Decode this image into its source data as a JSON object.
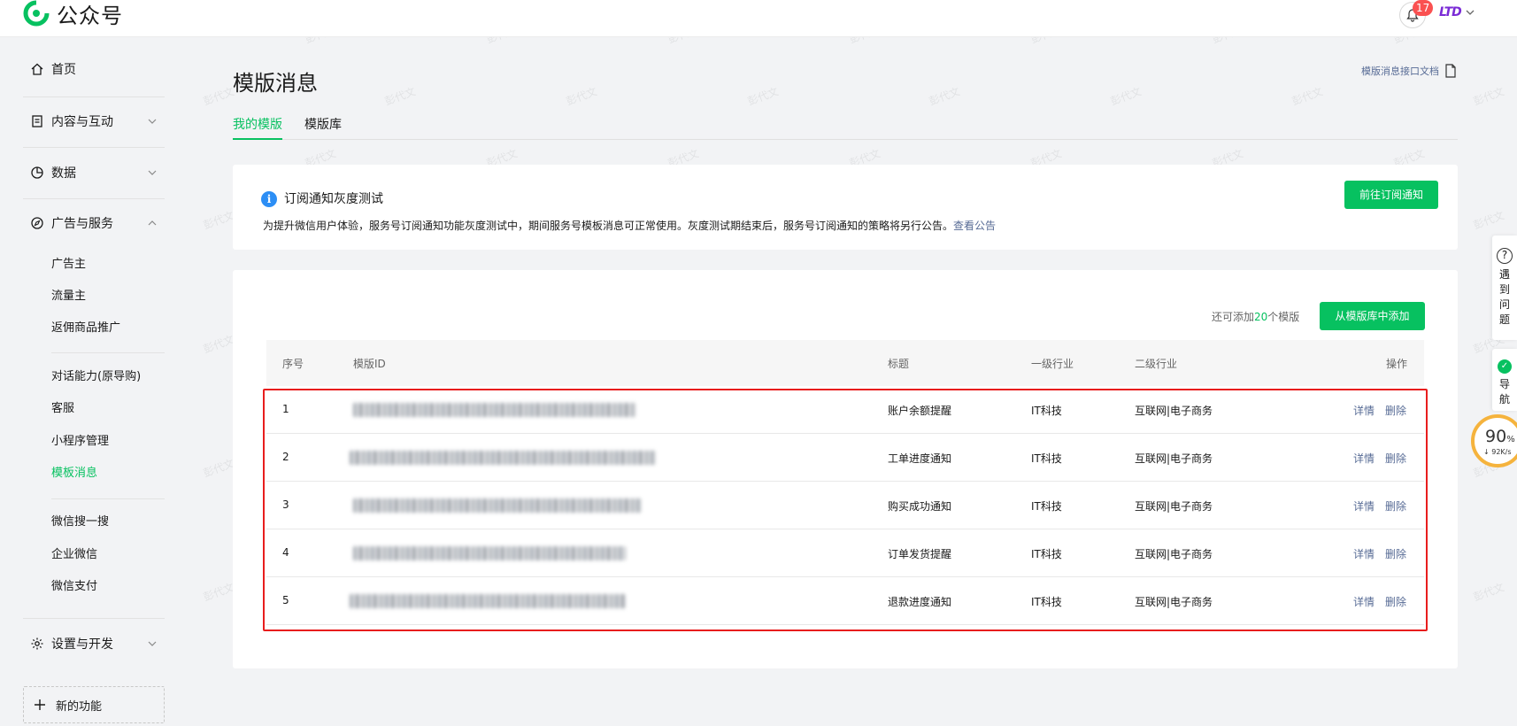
{
  "header": {
    "logo_text": "公众号",
    "notification_count": "17",
    "account_name": "LTD"
  },
  "sidebar": {
    "items": [
      {
        "label": "首页",
        "icon": "home-icon"
      },
      {
        "label": "内容与互动",
        "icon": "document-icon"
      },
      {
        "label": "数据",
        "icon": "pie-chart-icon"
      },
      {
        "label": "广告与服务",
        "icon": "compass-icon"
      },
      {
        "label": "设置与开发",
        "icon": "gear-icon"
      }
    ],
    "sub_items": [
      {
        "label": "广告主"
      },
      {
        "label": "流量主"
      },
      {
        "label": "返佣商品推广"
      },
      {
        "label": "对话能力(原导购)"
      },
      {
        "label": "客服"
      },
      {
        "label": "小程序管理"
      },
      {
        "label": "模板消息",
        "active": true
      },
      {
        "label": "微信搜一搜"
      },
      {
        "label": "企业微信"
      },
      {
        "label": "微信支付"
      }
    ],
    "new_feature_label": "新的功能"
  },
  "main": {
    "title": "模版消息",
    "doc_link": "模版消息接口文档",
    "tabs": [
      {
        "label": "我的模版",
        "active": true
      },
      {
        "label": "模版库"
      }
    ],
    "notice": {
      "title": "订阅通知灰度测试",
      "description": "为提升微信用户体验，服务号订阅通知功能灰度测试中，期间服务号模板消息可正常使用。灰度测试期结束后，服务号订阅通知的策略将另行公告。",
      "link_text": "查看公告",
      "button": "前往订阅通知"
    },
    "templates": {
      "remaining_prefix": "还可添加",
      "remaining_count": "20",
      "remaining_suffix": "个模版",
      "add_button": "从模版库中添加",
      "columns": [
        "序号",
        "模版ID",
        "标题",
        "一级行业",
        "二级行业",
        "操作"
      ],
      "rows": [
        {
          "index": "1",
          "title": "账户余额提醒",
          "industry1": "IT科技",
          "industry2": "互联网|电子商务"
        },
        {
          "index": "2",
          "title": "工单进度通知",
          "industry1": "IT科技",
          "industry2": "互联网|电子商务"
        },
        {
          "index": "3",
          "title": "购买成功通知",
          "industry1": "IT科技",
          "industry2": "互联网|电子商务"
        },
        {
          "index": "4",
          "title": "订单发货提醒",
          "industry1": "IT科技",
          "industry2": "互联网|电子商务"
        },
        {
          "index": "5",
          "title": "退款进度通知",
          "industry1": "IT科技",
          "industry2": "互联网|电子商务"
        }
      ],
      "detail_label": "详情",
      "delete_label": "删除"
    }
  },
  "floating": {
    "help_text": "遇到问题",
    "guide_text": "导航",
    "speed_percent": "90",
    "speed_unit": "%",
    "speed_rate": "92K/s"
  },
  "watermark": "彭代文",
  "colors": {
    "accent": "#07c160",
    "link": "#576b95",
    "highlight": "#e81d1d"
  }
}
